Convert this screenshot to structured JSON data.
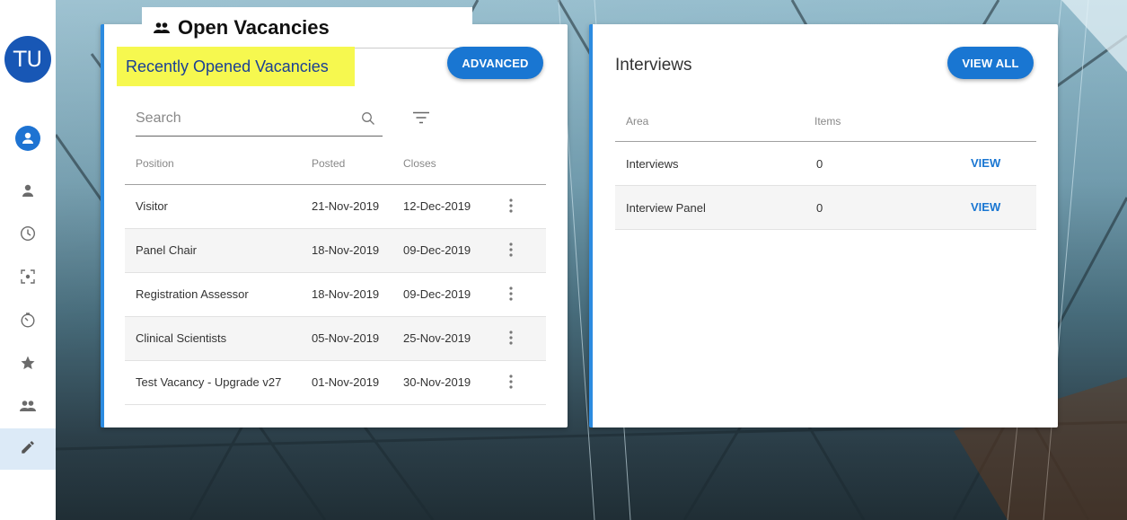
{
  "user": {
    "initials": "TU"
  },
  "sidebar": {
    "items": [
      {
        "icon": "account-circle-icon"
      },
      {
        "icon": "person-icon"
      },
      {
        "icon": "clock-icon"
      },
      {
        "icon": "focus-icon"
      },
      {
        "icon": "timer-icon"
      },
      {
        "icon": "star-icon"
      },
      {
        "icon": "people-icon"
      },
      {
        "icon": "pencil-icon"
      }
    ]
  },
  "page": {
    "title": "Open Vacancies"
  },
  "vacancies": {
    "title": "Recently Opened Vacancies",
    "advanced_label": "ADVANCED",
    "search_placeholder": "Search",
    "columns": [
      "Position",
      "Posted",
      "Closes"
    ],
    "rows": [
      {
        "position": "Visitor",
        "posted": "21-Nov-2019",
        "closes": "12-Dec-2019"
      },
      {
        "position": "Panel Chair",
        "posted": "18-Nov-2019",
        "closes": "09-Dec-2019"
      },
      {
        "position": "Registration Assessor",
        "posted": "18-Nov-2019",
        "closes": "09-Dec-2019"
      },
      {
        "position": "Clinical Scientists",
        "posted": "05-Nov-2019",
        "closes": "25-Nov-2019"
      },
      {
        "position": "Test Vacancy - Upgrade v27",
        "posted": "01-Nov-2019",
        "closes": "30-Nov-2019"
      }
    ]
  },
  "interviews": {
    "title": "Interviews",
    "view_all_label": "VIEW ALL",
    "columns": [
      "Area",
      "Items"
    ],
    "rows": [
      {
        "area": "Interviews",
        "items": "0",
        "action": "VIEW"
      },
      {
        "area": "Interview Panel",
        "items": "0",
        "action": "VIEW"
      }
    ]
  },
  "colors": {
    "accent": "#1976d2",
    "highlight": "#f6f84f",
    "avatar": "#1857b5"
  }
}
